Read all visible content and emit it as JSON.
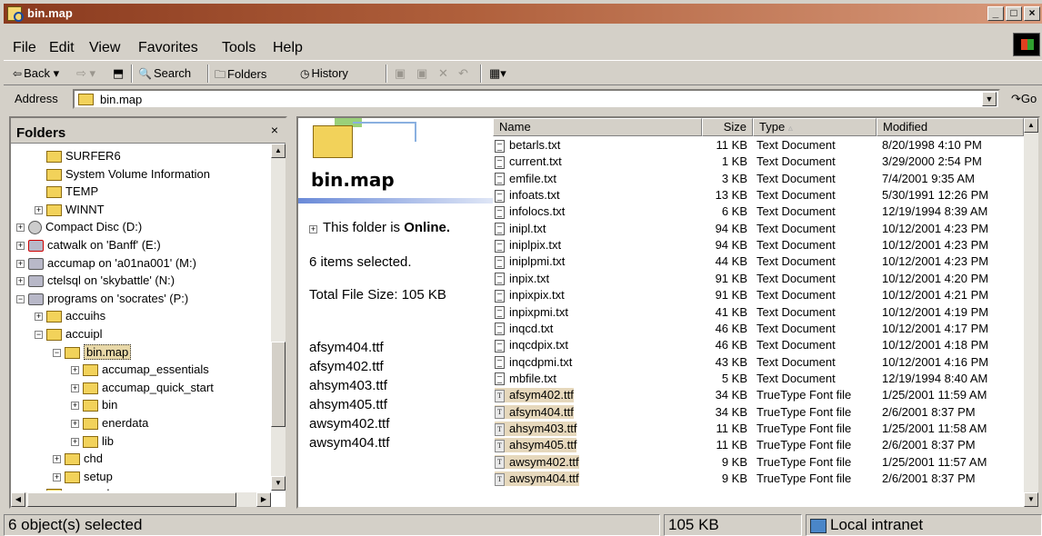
{
  "window": {
    "title": "bin.map"
  },
  "menu": [
    "File",
    "Edit",
    "View",
    "Favorites",
    "Tools",
    "Help"
  ],
  "toolbar": {
    "back": "Back",
    "search": "Search",
    "folders": "Folders",
    "history": "History"
  },
  "address": {
    "label": "Address",
    "value": "bin.map",
    "go": "Go"
  },
  "folders_pane": {
    "title": "Folders",
    "close": "×",
    "items": [
      {
        "label": "SURFER6",
        "indent": 2,
        "icon": "folder"
      },
      {
        "label": "System Volume Information",
        "indent": 2,
        "icon": "folder"
      },
      {
        "label": "TEMP",
        "indent": 2,
        "icon": "folder"
      },
      {
        "label": "WINNT",
        "indent": 2,
        "icon": "folder",
        "expander": "+"
      },
      {
        "label": "Compact Disc (D:)",
        "indent": 1,
        "icon": "cd",
        "expander": "+"
      },
      {
        "label": "catwalk on 'Banff' (E:)",
        "indent": 1,
        "icon": "netdrive-disconnected",
        "expander": "+"
      },
      {
        "label": "accumap on 'a01na001' (M:)",
        "indent": 1,
        "icon": "netdrive",
        "expander": "+"
      },
      {
        "label": "ctelsql on 'skybattle' (N:)",
        "indent": 1,
        "icon": "netdrive",
        "expander": "+"
      },
      {
        "label": "programs on 'socrates' (P:)",
        "indent": 1,
        "icon": "netdrive",
        "expander": "-"
      },
      {
        "label": "accuihs",
        "indent": 2,
        "icon": "folder",
        "expander": "+"
      },
      {
        "label": "accuipl",
        "indent": 2,
        "icon": "folder",
        "expander": "-"
      },
      {
        "label": "bin.map",
        "indent": 3,
        "icon": "folder-open",
        "expander": "-",
        "selected": true
      },
      {
        "label": "accumap_essentials",
        "indent": 4,
        "icon": "folder",
        "expander": "+"
      },
      {
        "label": "accumap_quick_start",
        "indent": 4,
        "icon": "folder",
        "expander": "+"
      },
      {
        "label": "bin",
        "indent": 4,
        "icon": "folder",
        "expander": "+"
      },
      {
        "label": "enerdata",
        "indent": 4,
        "icon": "folder",
        "expander": "+"
      },
      {
        "label": "lib",
        "indent": 4,
        "icon": "folder",
        "expander": "+"
      },
      {
        "label": "chd",
        "indent": 3,
        "icon": "folder",
        "expander": "+"
      },
      {
        "label": "setup",
        "indent": 3,
        "icon": "folder",
        "expander": "+"
      },
      {
        "label": "accucarl",
        "indent": 2,
        "icon": "folder",
        "expander": "+"
      }
    ]
  },
  "info": {
    "folder_name": "bin.map",
    "online_prefix": "This folder is ",
    "online_word": "Online.",
    "selected": "6 items selected.",
    "total": "Total File Size: 105 KB",
    "selected_files": [
      "afsym404.ttf",
      "afsym402.ttf",
      "ahsym403.ttf",
      "ahsym405.ttf",
      "awsym402.ttf",
      "awsym404.ttf"
    ]
  },
  "list": {
    "columns": {
      "name": "Name",
      "size": "Size",
      "type": "Type",
      "modified": "Modified"
    },
    "rows": [
      {
        "name": "betarls.txt",
        "size": "11 KB",
        "type": "Text Document",
        "modified": "8/20/1998 4:10 PM",
        "kind": "txt"
      },
      {
        "name": "current.txt",
        "size": "1 KB",
        "type": "Text Document",
        "modified": "3/29/2000 2:54 PM",
        "kind": "txt"
      },
      {
        "name": "emfile.txt",
        "size": "3 KB",
        "type": "Text Document",
        "modified": "7/4/2001 9:35 AM",
        "kind": "txt"
      },
      {
        "name": "infoats.txt",
        "size": "13 KB",
        "type": "Text Document",
        "modified": "5/30/1991 12:26 PM",
        "kind": "txt"
      },
      {
        "name": "infolocs.txt",
        "size": "6 KB",
        "type": "Text Document",
        "modified": "12/19/1994 8:39 AM",
        "kind": "txt"
      },
      {
        "name": "inipl.txt",
        "size": "94 KB",
        "type": "Text Document",
        "modified": "10/12/2001 4:23 PM",
        "kind": "txt"
      },
      {
        "name": "iniplpix.txt",
        "size": "94 KB",
        "type": "Text Document",
        "modified": "10/12/2001 4:23 PM",
        "kind": "txt"
      },
      {
        "name": "iniplpmi.txt",
        "size": "44 KB",
        "type": "Text Document",
        "modified": "10/12/2001 4:23 PM",
        "kind": "txt"
      },
      {
        "name": "inpix.txt",
        "size": "91 KB",
        "type": "Text Document",
        "modified": "10/12/2001 4:20 PM",
        "kind": "txt"
      },
      {
        "name": "inpixpix.txt",
        "size": "91 KB",
        "type": "Text Document",
        "modified": "10/12/2001 4:21 PM",
        "kind": "txt"
      },
      {
        "name": "inpixpmi.txt",
        "size": "41 KB",
        "type": "Text Document",
        "modified": "10/12/2001 4:19 PM",
        "kind": "txt"
      },
      {
        "name": "inqcd.txt",
        "size": "46 KB",
        "type": "Text Document",
        "modified": "10/12/2001 4:17 PM",
        "kind": "txt"
      },
      {
        "name": "inqcdpix.txt",
        "size": "46 KB",
        "type": "Text Document",
        "modified": "10/12/2001 4:18 PM",
        "kind": "txt"
      },
      {
        "name": "inqcdpmi.txt",
        "size": "43 KB",
        "type": "Text Document",
        "modified": "10/12/2001 4:16 PM",
        "kind": "txt"
      },
      {
        "name": "mbfile.txt",
        "size": "5 KB",
        "type": "Text Document",
        "modified": "12/19/1994 8:40 AM",
        "kind": "txt"
      },
      {
        "name": "afsym402.ttf",
        "size": "34 KB",
        "type": "TrueType Font file",
        "modified": "1/25/2001 11:59 AM",
        "kind": "font",
        "selected": true
      },
      {
        "name": "afsym404.ttf",
        "size": "34 KB",
        "type": "TrueType Font file",
        "modified": "2/6/2001 8:37 PM",
        "kind": "font",
        "selected": true
      },
      {
        "name": "ahsym403.ttf",
        "size": "11 KB",
        "type": "TrueType Font file",
        "modified": "1/25/2001 11:58 AM",
        "kind": "font",
        "selected": true
      },
      {
        "name": "ahsym405.ttf",
        "size": "11 KB",
        "type": "TrueType Font file",
        "modified": "2/6/2001 8:37 PM",
        "kind": "font",
        "selected": true
      },
      {
        "name": "awsym402.ttf",
        "size": "9 KB",
        "type": "TrueType Font file",
        "modified": "1/25/2001 11:57 AM",
        "kind": "font",
        "selected": true
      },
      {
        "name": "awsym404.ttf",
        "size": "9 KB",
        "type": "TrueType Font file",
        "modified": "2/6/2001 8:37 PM",
        "kind": "font",
        "selected": true
      }
    ]
  },
  "status": {
    "objects": "6 object(s) selected",
    "size": "105 KB",
    "zone": "Local intranet"
  }
}
